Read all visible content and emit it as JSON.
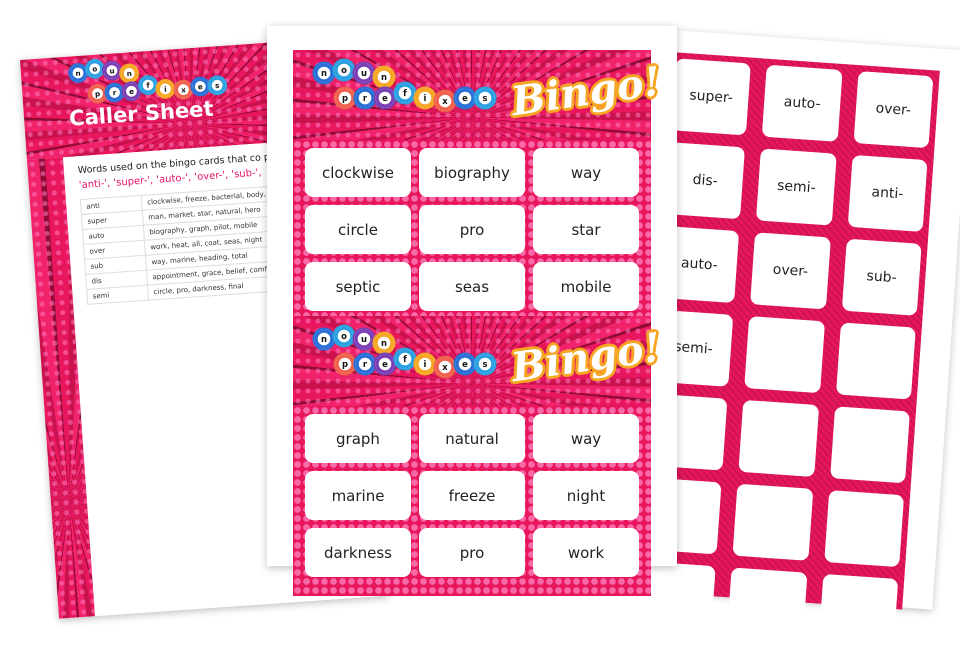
{
  "logo": {
    "word1": [
      "n",
      "o",
      "u",
      "n"
    ],
    "word2": [
      "p",
      "r",
      "e",
      "f",
      "i",
      "x",
      "e",
      "s"
    ],
    "bingo": "Bingo!",
    "ball_colors": [
      "#2a6fd6",
      "#2aa0e0",
      "#7b3fb5",
      "#f6a623",
      "#f0604d",
      "#2a6fd6",
      "#7b3fb5",
      "#2aa0e0",
      "#f6a623",
      "#f0604d",
      "#2a6fd6",
      "#2aa0e0"
    ]
  },
  "caller_sheet": {
    "title": "Caller Sheet",
    "intro": "Words used on the bingo cards that co prefix added.",
    "prefixes": "'anti-', 'super-', 'auto-', 'over-', 'sub-',",
    "rows": [
      {
        "prefix": "anti",
        "words": "clockwise, freeze, bacterial, body,"
      },
      {
        "prefix": "super",
        "words": "man, market, star, natural, hero"
      },
      {
        "prefix": "auto",
        "words": "biography, graph, pilot, mobile"
      },
      {
        "prefix": "over",
        "words": "work, heat, all, coat, seas, night"
      },
      {
        "prefix": "sub",
        "words": "way, marine, heading, total"
      },
      {
        "prefix": "dis",
        "words": "appointment, grace, belief, comfo"
      },
      {
        "prefix": "semi",
        "words": "circle, pro, darkness, final"
      }
    ]
  },
  "bingo_cards": [
    {
      "cells": [
        "clockwise",
        "biography",
        "way",
        "circle",
        "pro",
        "star",
        "septic",
        "seas",
        "mobile"
      ]
    },
    {
      "cells": [
        "graph",
        "natural",
        "way",
        "marine",
        "freeze",
        "night",
        "darkness",
        "pro",
        "work"
      ]
    }
  ],
  "prefix_tiles": [
    "super-",
    "auto-",
    "over-",
    "dis-",
    "semi-",
    "anti-",
    "auto-",
    "over-",
    "sub-",
    "semi-",
    "",
    "",
    "",
    "",
    "",
    "",
    "",
    "",
    "",
    "",
    ""
  ]
}
